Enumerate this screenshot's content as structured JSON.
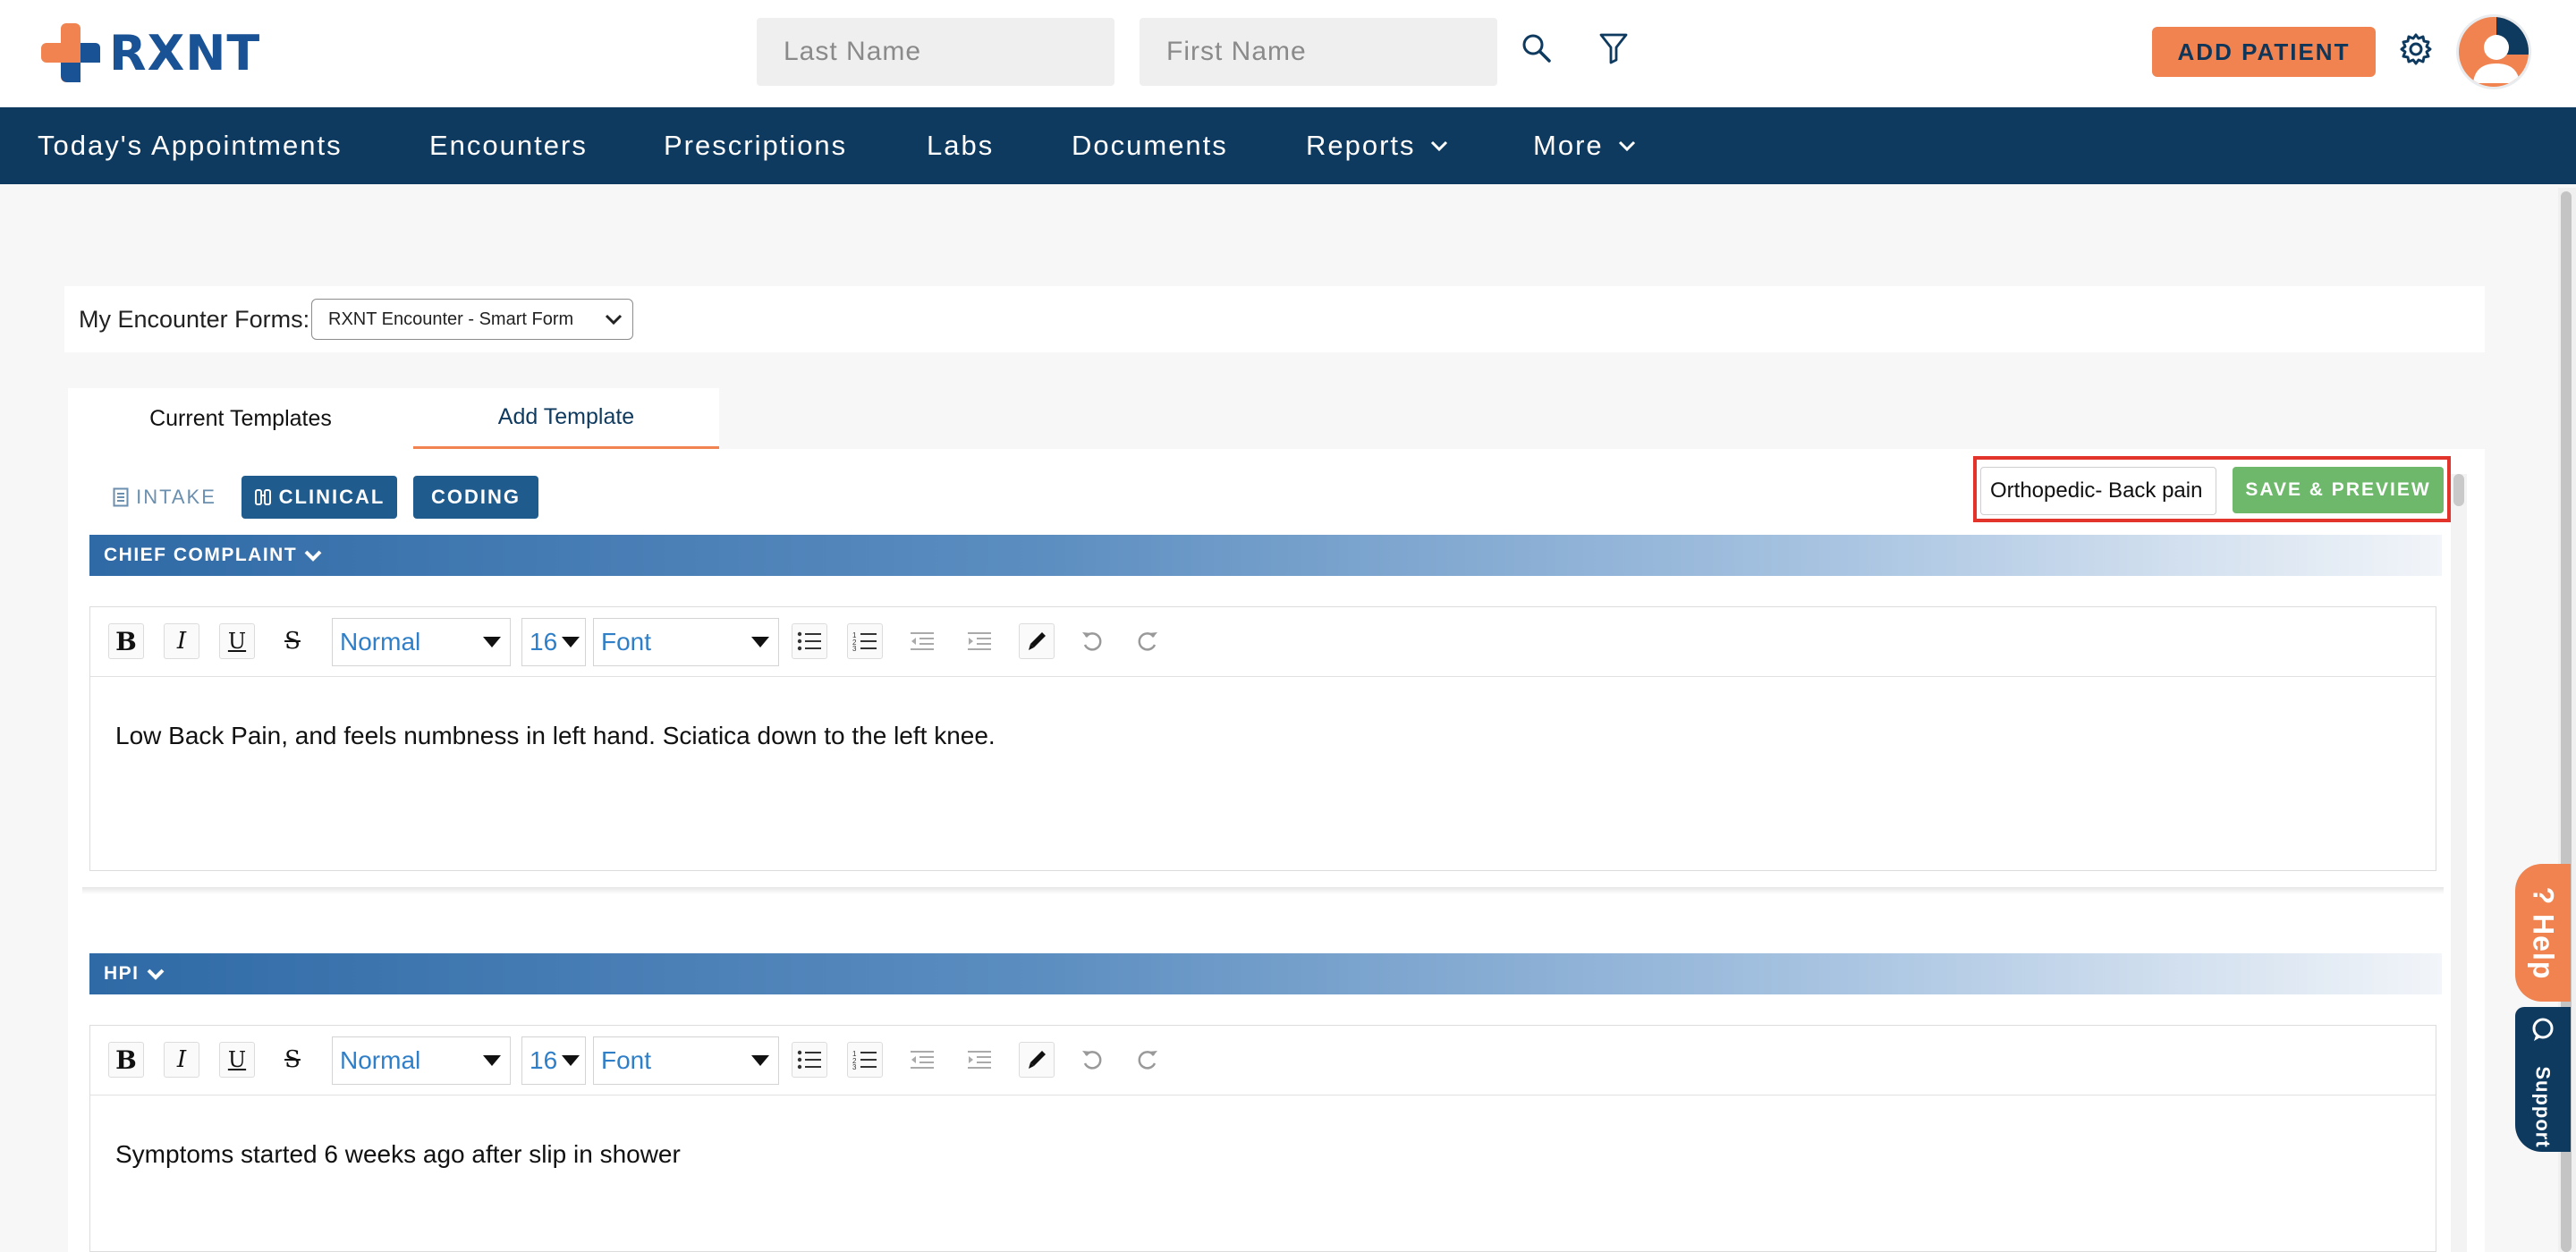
{
  "brand": {
    "name": "RXNT",
    "primary_color": "#1a5296",
    "accent_color": "#f0834f"
  },
  "header": {
    "last_name_placeholder": "Last Name",
    "first_name_placeholder": "First Name",
    "add_patient_label": "ADD PATIENT",
    "icons": [
      "search-icon",
      "filter-icon",
      "gear-icon",
      "avatar"
    ]
  },
  "nav": {
    "items": [
      {
        "label": "Today's Appointments"
      },
      {
        "label": "Encounters"
      },
      {
        "label": "Prescriptions"
      },
      {
        "label": "Labs"
      },
      {
        "label": "Documents"
      },
      {
        "label": "Reports",
        "has_dropdown": true
      },
      {
        "label": "More",
        "has_dropdown": true
      }
    ]
  },
  "forms": {
    "label": "My Encounter Forms:",
    "selected": "RXNT Encounter - Smart Form"
  },
  "tabs": [
    {
      "label": "Current Templates",
      "active": false
    },
    {
      "label": "Add Template",
      "active": true
    }
  ],
  "section_tabs": [
    {
      "label": "INTAKE",
      "icon": "document-icon"
    },
    {
      "label": "CLINICAL",
      "icon": "binoculars-icon"
    },
    {
      "label": "CODING",
      "icon": ""
    }
  ],
  "template": {
    "name_value": "Orthopedic- Back pain",
    "save_label": "SAVE & PREVIEW"
  },
  "toolbar": {
    "block_format": "Normal",
    "font_size": "16",
    "font_family": "Font"
  },
  "sections": [
    {
      "title": "CHIEF COMPLAINT",
      "content": "Low Back Pain, and feels numbness in left hand. Sciatica down to the left knee."
    },
    {
      "title": "HPI",
      "content": "Symptoms started 6 weeks ago after slip in shower"
    }
  ],
  "widget": {
    "help_label": "Help",
    "support_label": "Support"
  }
}
